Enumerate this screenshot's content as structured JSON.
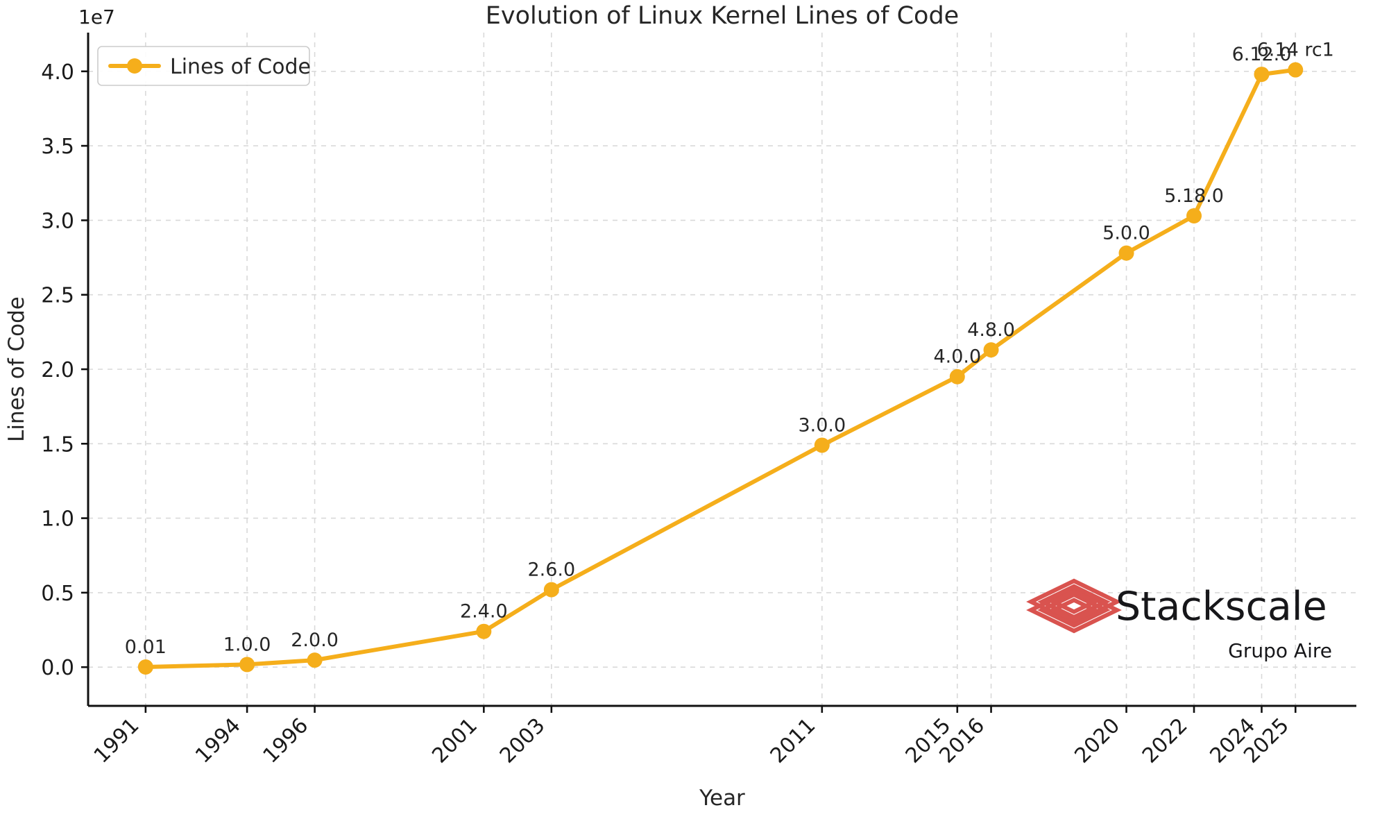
{
  "chart_data": {
    "type": "line",
    "title": "Evolution of Linux Kernel Lines of Code",
    "xlabel": "Year",
    "ylabel": "Lines of Code",
    "y_offset_text": "1e7",
    "y_offset_multiplier": 10000000,
    "xlim": [
      1989.3,
      2026.8
    ],
    "ylim": [
      -2600000,
      42600000
    ],
    "ytick_labels": [
      "0.0",
      "0.5",
      "1.0",
      "1.5",
      "2.0",
      "2.5",
      "3.0",
      "3.5",
      "4.0"
    ],
    "ytick_values": [
      0,
      5000000,
      10000000,
      15000000,
      20000000,
      25000000,
      30000000,
      35000000,
      40000000
    ],
    "xtick_labels": [
      "1991",
      "1994",
      "1996",
      "2001",
      "2003",
      "2011",
      "2015",
      "2016",
      "2020",
      "2022",
      "2024",
      "2025"
    ],
    "xtick_values": [
      1991,
      1994,
      1996,
      2001,
      2003,
      2011,
      2015,
      2016,
      2020,
      2022,
      2024,
      2025
    ],
    "xtick_rotation_deg": 45,
    "grid": true,
    "legend_position": "upper left",
    "line_color": "#F5AE1B",
    "marker_color": "#F5AE1B",
    "series": [
      {
        "name": "Lines of Code",
        "x": [
          1991,
          1994,
          1996,
          2001,
          2003,
          2011,
          2015,
          2016,
          2020,
          2022,
          2024,
          2025
        ],
        "values": [
          10000,
          176250,
          470000,
          2400000,
          5200000,
          14900000,
          19500000,
          21300000,
          27800000,
          30300000,
          39800000,
          40100000
        ],
        "point_labels": [
          "0.01",
          "1.0.0",
          "2.0.0",
          "2.4.0",
          "2.6.0",
          "3.0.0",
          "4.0.0",
          "4.8.0",
          "5.0.0",
          "5.18.0",
          "6.12.0",
          "6.14 rc1"
        ]
      }
    ]
  },
  "legend": {
    "entries": [
      {
        "label": "Lines of Code"
      }
    ]
  },
  "watermark": {
    "brand": "Stackscale",
    "tagline": "Grupo Aire",
    "logo_color": "#D9534F"
  }
}
